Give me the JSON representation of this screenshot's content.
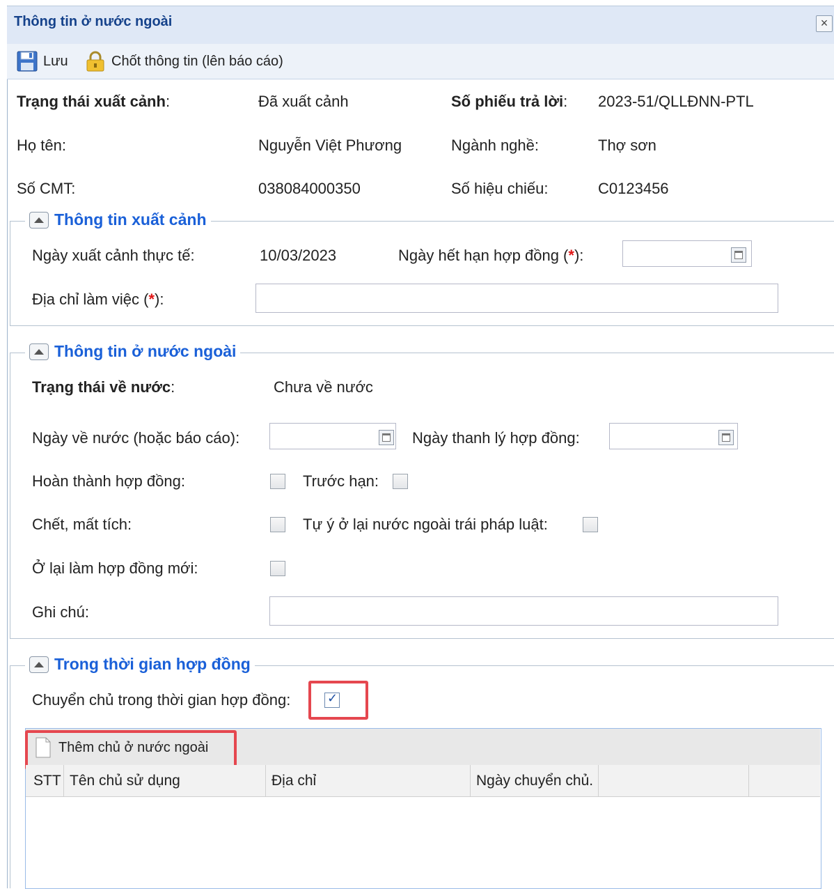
{
  "window": {
    "title": "Thông tin ở nước ngoài",
    "close_symbol": "×"
  },
  "toolbar": {
    "save_label": "Lưu",
    "lock_label": "Chốt thông tin (lên báo cáo)"
  },
  "summary": {
    "exit_status_label": "Trạng thái xuất cảnh",
    "exit_status_colon": ":",
    "exit_status_value": "Đã xuất cảnh",
    "reply_no_label": "Số phiếu trả lời",
    "reply_no_colon": ":",
    "reply_no_value": "2023-51/QLLĐNN-PTL",
    "name_label": "Họ tên:",
    "name_value": "Nguyễn Việt Phương",
    "occupation_label": "Ngành nghề:",
    "occupation_value": "Thợ sơn",
    "id_label": "Số CMT:",
    "id_value": "038084000350",
    "passport_label": "Số hiệu chiếu:",
    "passport_value": "C0123456"
  },
  "exit_info": {
    "legend": "Thông tin xuất cảnh",
    "actual_exit_label": "Ngày xuất cảnh thực tế:",
    "actual_exit_value": "10/03/2023",
    "contract_expiry_label": "Ngày hết hạn hợp đồng (",
    "contract_expiry_req": "*",
    "contract_expiry_tail": "):",
    "contract_expiry_value": "",
    "work_address_label": "Địa chỉ làm việc (",
    "work_address_req": "*",
    "work_address_tail": "):",
    "work_address_value": ""
  },
  "abroad_info": {
    "legend": "Thông tin ở nước ngoài",
    "return_status_label": "Trạng thái về nước",
    "return_status_colon": ":",
    "return_status_value": "Chưa về nước",
    "return_date_label": "Ngày về nước (hoặc báo cáo):",
    "return_date_value": "",
    "liquidation_date_label": "Ngày thanh lý hợp đồng:",
    "liquidation_date_value": "",
    "completed_label": "Hoàn thành hợp đồng:",
    "completed_checked": false,
    "early_label": "Trước hạn:",
    "early_checked": false,
    "dead_missing_label": "Chết, mất tích:",
    "dead_missing_checked": false,
    "illegal_stay_label": "Tự ý ở lại nước ngoài trái pháp luật:",
    "illegal_stay_checked": false,
    "new_contract_label": "Ở lại làm hợp đồng mới:",
    "new_contract_checked": false,
    "note_label": "Ghi chú:",
    "note_value": ""
  },
  "contract_period": {
    "legend": "Trong thời gian hợp đồng",
    "change_employer_label": "Chuyển chủ trong thời gian hợp đồng:",
    "change_employer_checked": true,
    "add_employer_button": "Thêm chủ ở nước ngoài",
    "columns": [
      "STT",
      "Tên chủ sử dụng",
      "Địa chỉ",
      "Ngày chuyển chủ."
    ],
    "rows": []
  },
  "colors": {
    "legend": "#1a60d8",
    "title": "#15428b",
    "highlight": "#e5474f",
    "required": "#e01616"
  }
}
